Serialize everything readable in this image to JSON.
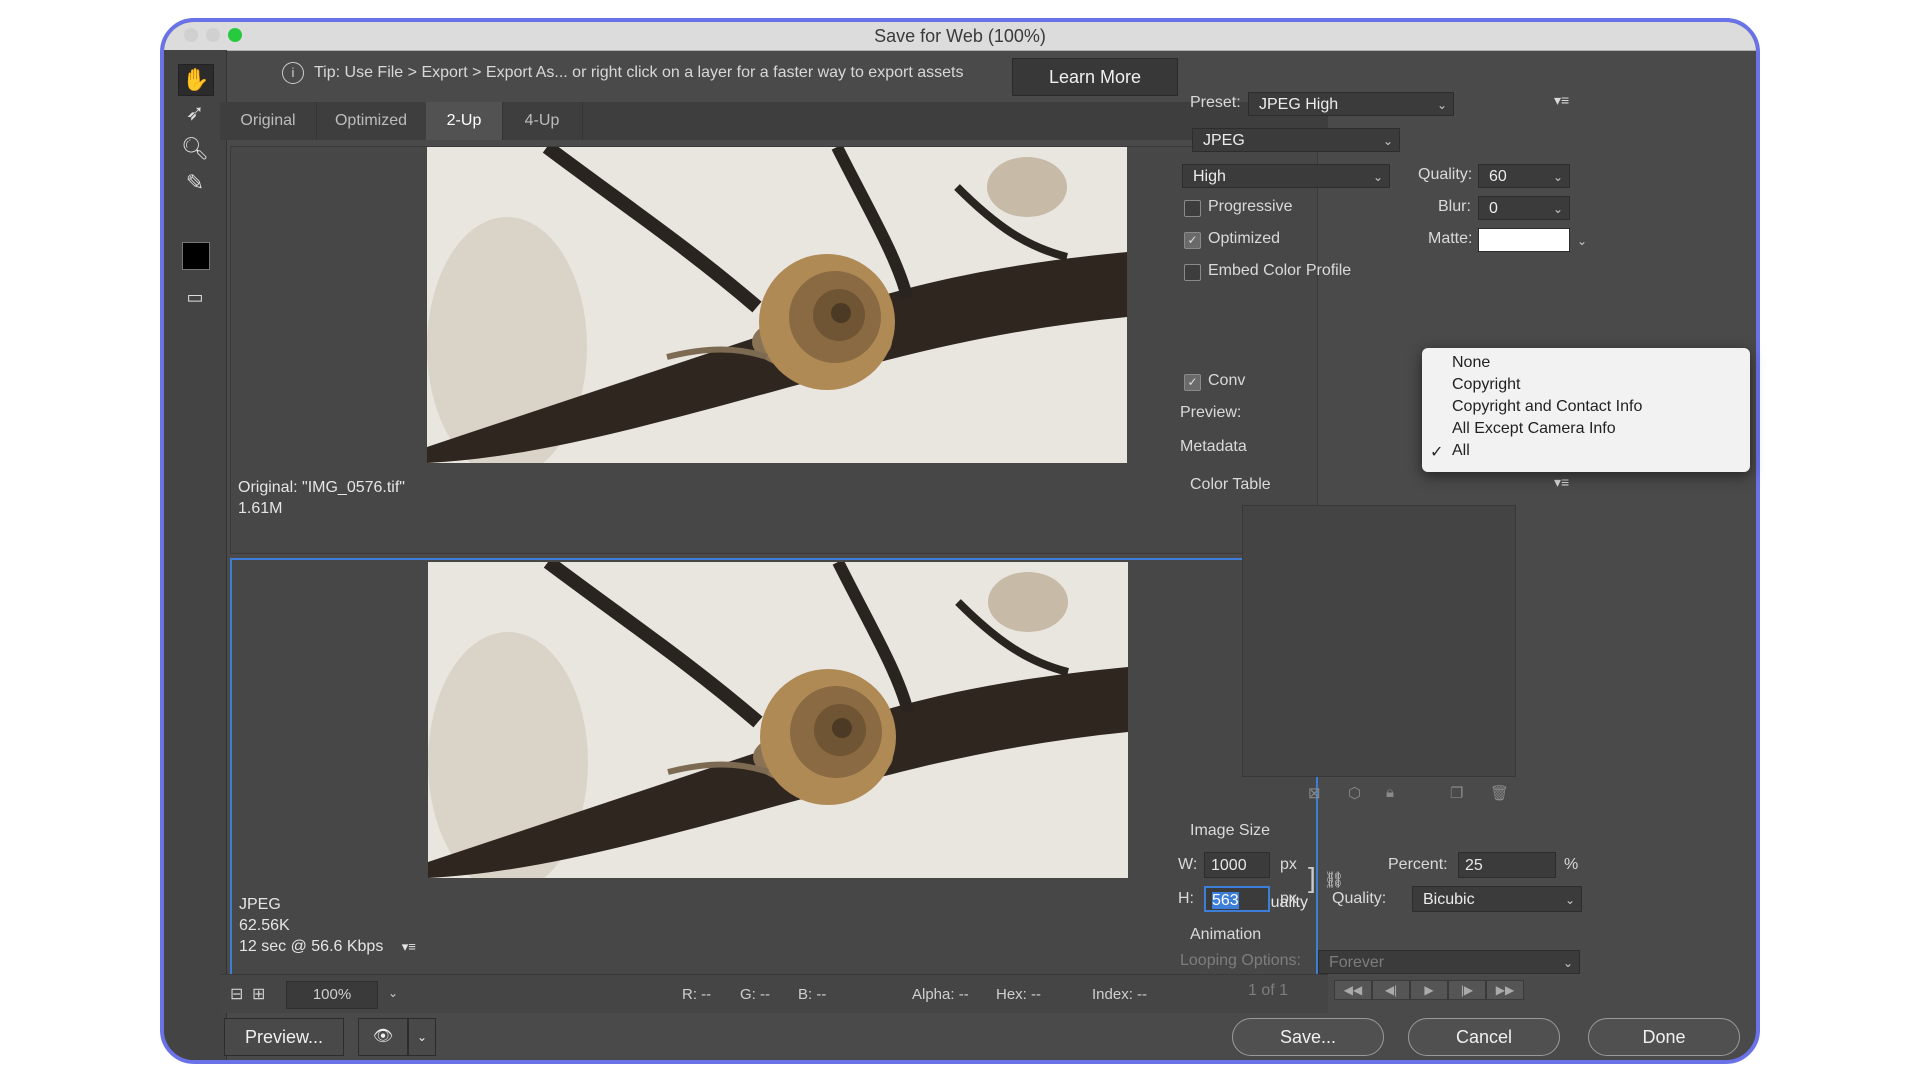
{
  "window": {
    "title": "Save for Web (100%)"
  },
  "tip": {
    "text": "Tip: Use File > Export > Export As...  or right click on a layer for a faster way to export assets",
    "learn_more": "Learn More"
  },
  "tabs": [
    {
      "label": "Original"
    },
    {
      "label": "Optimized"
    },
    {
      "label": "2-Up"
    },
    {
      "label": "4-Up"
    }
  ],
  "original_pane": {
    "line1": "Original: \"IMG_0576.tif\"",
    "line2": "1.61M"
  },
  "optimized_pane": {
    "line1": "JPEG",
    "line2": "62.56K",
    "line3": "12 sec @ 56.6 Kbps",
    "quality": "60 quality"
  },
  "status": {
    "zoom": "100%",
    "r": "R: --",
    "g": "G: --",
    "b": "B: --",
    "alpha": "Alpha: --",
    "hex": "Hex: --",
    "index": "Index: --"
  },
  "bottom": {
    "preview": "Preview...",
    "save": "Save...",
    "cancel": "Cancel",
    "done": "Done"
  },
  "settings": {
    "preset_label": "Preset:",
    "preset": "JPEG High",
    "format": "JPEG",
    "compression": "High",
    "quality_label": "Quality:",
    "quality": "60",
    "blur_label": "Blur:",
    "blur": "0",
    "matte_label": "Matte:",
    "progressive": "Progressive",
    "optimized": "Optimized",
    "embed": "Embed Color Profile",
    "convert": "Conv",
    "preview_label": "Preview:",
    "metadata_label": "Metadata"
  },
  "metadata_menu": {
    "items": [
      "None",
      "Copyright",
      "Copyright and Contact Info",
      "All Except Camera Info",
      "All"
    ],
    "selected": "All"
  },
  "color_table": {
    "label": "Color Table"
  },
  "image_size": {
    "label": "Image Size",
    "w_label": "W:",
    "w": "1000",
    "h_label": "H:",
    "h": "563",
    "unit": "px",
    "percent_label": "Percent:",
    "percent": "25",
    "pct": "%",
    "quality_label": "Quality:",
    "quality": "Bicubic"
  },
  "animation": {
    "label": "Animation",
    "looping_label": "Looping Options:",
    "looping": "Forever",
    "frames": "1 of 1"
  }
}
